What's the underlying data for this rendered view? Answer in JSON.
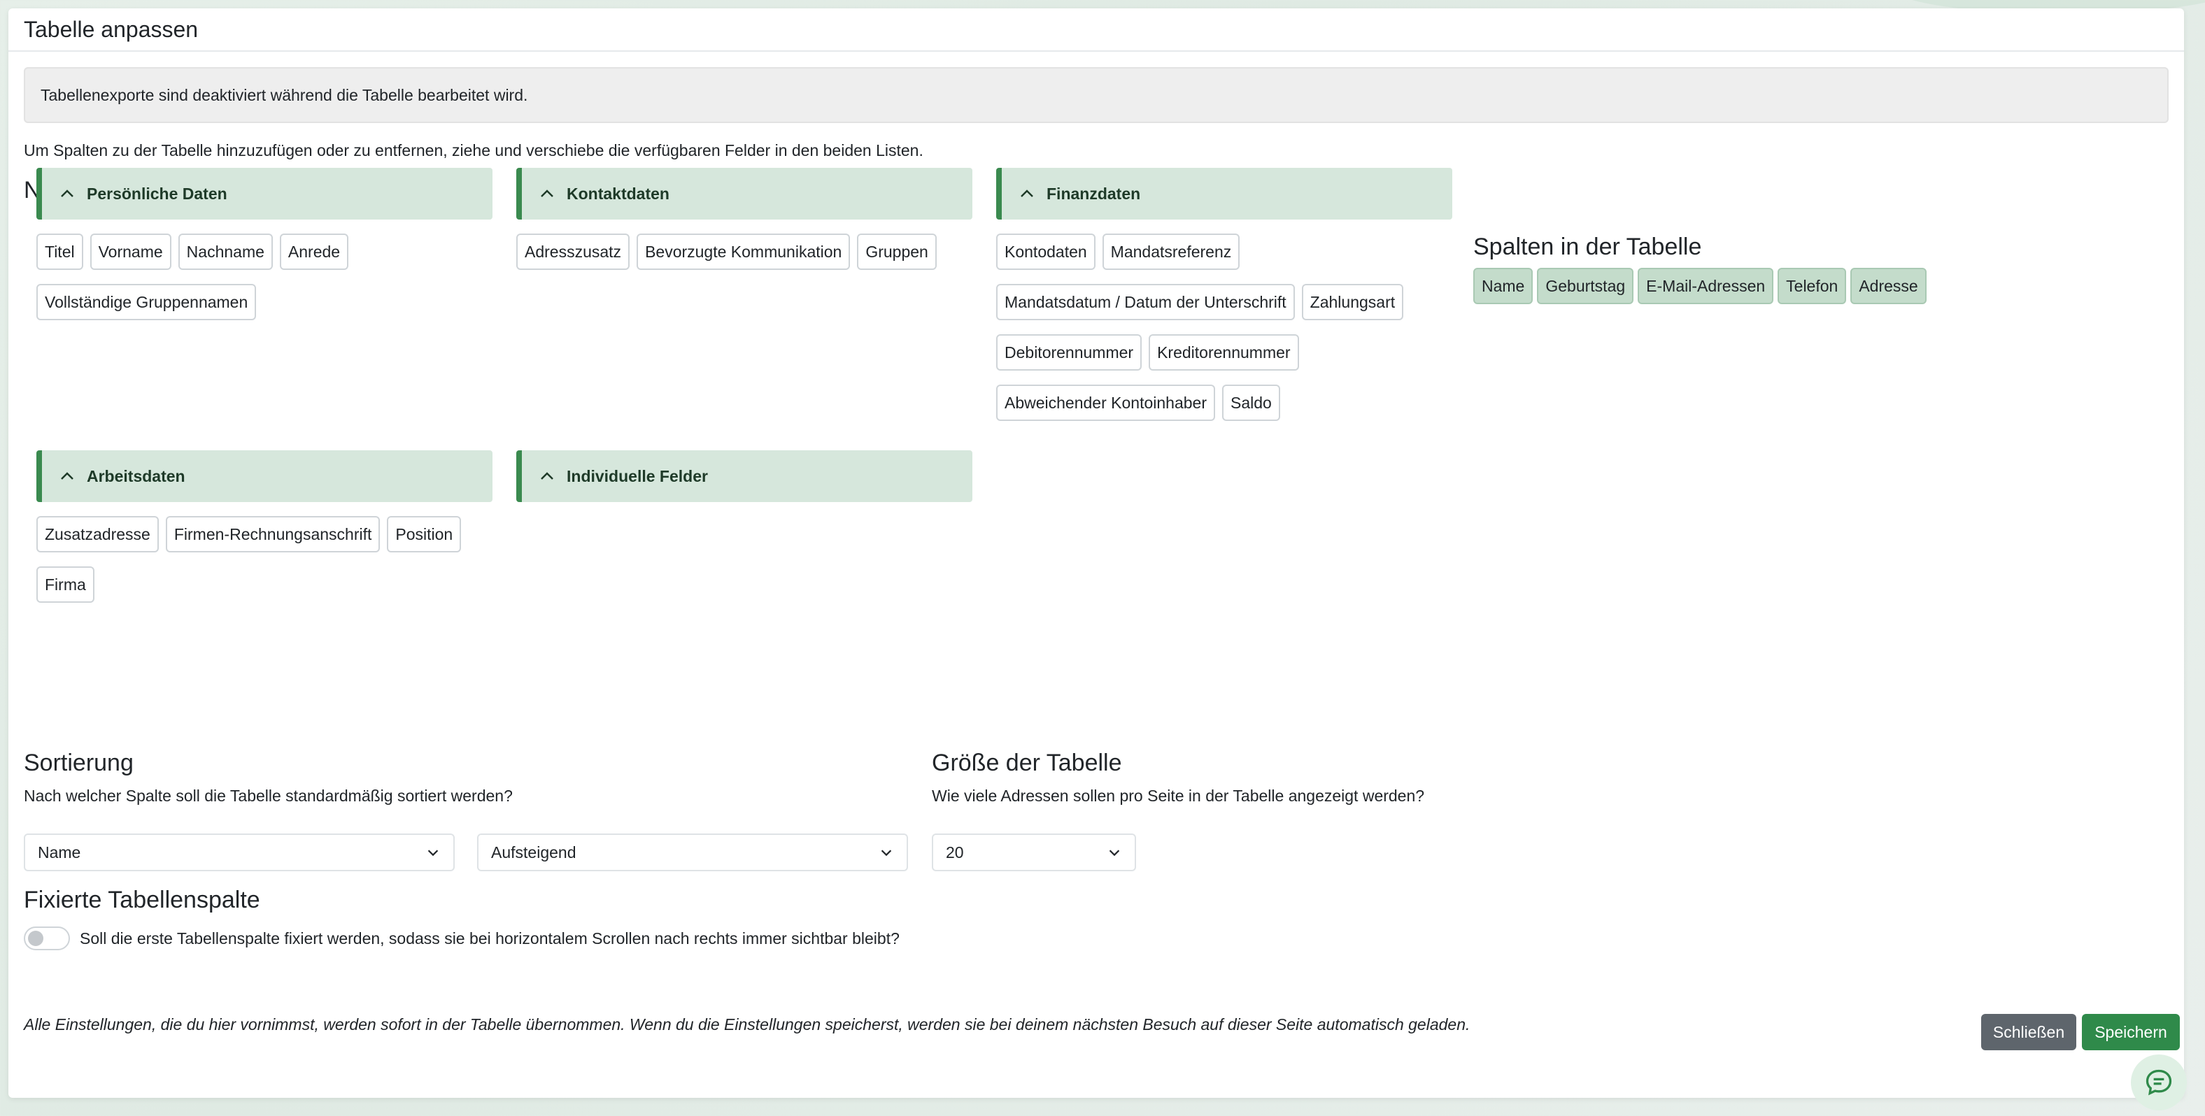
{
  "modal": {
    "title": "Tabelle anpassen"
  },
  "notice": "Tabellenexporte sind deaktiviert während die Tabelle bearbeitet wird.",
  "hint": "Um Spalten zu der Tabelle hinzuzufügen oder zu entfernen, ziehe und verschiebe die verfügbaren Felder in den beiden Listen.",
  "not_in_table": {
    "title": "Nicht in der Tabelle",
    "groups": [
      {
        "label": "Persönliche Daten",
        "fields": [
          "Titel",
          "Vorname",
          "Nachname",
          "Anrede",
          "Vollständige Gruppennamen"
        ]
      },
      {
        "label": "Kontaktdaten",
        "fields": [
          "Adresszusatz",
          "Bevorzugte Kommunikation",
          "Gruppen"
        ]
      },
      {
        "label": "Finanzdaten",
        "fields": [
          "Kontodaten",
          "Mandatsreferenz",
          "Mandatsdatum / Datum der Unterschrift",
          "Zahlungsart",
          "Debitorennummer",
          "Kreditorennummer",
          "Abweichender Kontoinhaber",
          "Saldo"
        ]
      },
      {
        "label": "Arbeitsdaten",
        "fields": [
          "Zusatzadresse",
          "Firmen-Rechnungsanschrift",
          "Position",
          "Firma"
        ]
      },
      {
        "label": "Individuelle Felder",
        "fields": []
      }
    ]
  },
  "in_table": {
    "title": "Spalten in der Tabelle",
    "fields": [
      "Name",
      "Geburtstag",
      "E-Mail-Adressen",
      "Telefon",
      "Adresse"
    ]
  },
  "sorting": {
    "title": "Sortierung",
    "question": "Nach welcher Spalte soll die Tabelle standardmäßig sortiert werden?",
    "column_value": "Name",
    "direction_value": "Aufsteigend"
  },
  "table_size": {
    "title": "Größe der Tabelle",
    "question": "Wie viele Adressen sollen pro Seite in der Tabelle angezeigt werden?",
    "value": "20"
  },
  "fixed_column": {
    "title": "Fixierte Tabellenspalte",
    "question": "Soll die erste Tabellenspalte fixiert werden, sodass sie bei horizontalem Scrollen nach rechts immer sichtbar bleibt?",
    "enabled": false
  },
  "footer": {
    "note": "Alle Einstellungen, die du hier vornimmst, werden sofort in der Tabelle übernommen. Wenn du die Einstellungen speicherst, werden sie bei deinem nächsten Besuch auf dieser Seite automatisch geladen.",
    "close_label": "Schließen",
    "save_label": "Speichern"
  },
  "icons": {
    "group_toggle": "chevron-up-icon",
    "select_arrow": "chevron-down-icon",
    "chat": "chat-icon"
  },
  "colors": {
    "accent": "#3a8a4f",
    "group_bg": "#d6e7dc",
    "save": "#2f8a4a",
    "close": "#5e656c"
  }
}
